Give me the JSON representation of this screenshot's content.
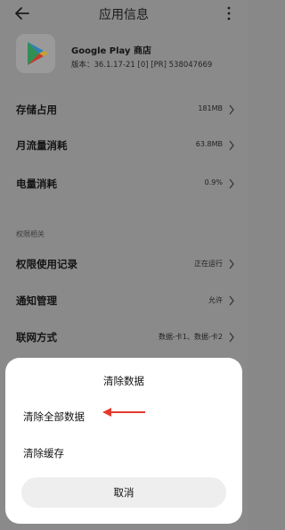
{
  "header": {
    "title": "应用信息"
  },
  "app": {
    "name": "Google Play 商店",
    "version": "版本：36.1.17-21 [0] [PR] 538047669"
  },
  "rows": [
    {
      "label": "存储占用",
      "value": "181MB"
    },
    {
      "label": "月流量消耗",
      "value": "63.8MB"
    },
    {
      "label": "电量消耗",
      "value": "0.9%"
    },
    {
      "label": "权限使用记录",
      "value": "正在运行"
    },
    {
      "label": "通知管理",
      "value": "允许"
    },
    {
      "label": "联网方式",
      "value": "数据-卡1、数据-卡2"
    }
  ],
  "section": {
    "permissions": "权限相关"
  },
  "dialog": {
    "title": "清除数据",
    "clear_all": "清除全部数据",
    "clear_cache": "清除缓存",
    "cancel": "取消"
  },
  "colors": {
    "dim_bg": "#888888",
    "sheet_bg": "#ffffff",
    "cancel_bg": "#eeeeee",
    "arrow": "#e23a2e"
  },
  "icons": [
    "back-arrow-icon",
    "more-icon",
    "google-play-icon",
    "chevron-right-icon",
    "red-arrow-annotation"
  ]
}
